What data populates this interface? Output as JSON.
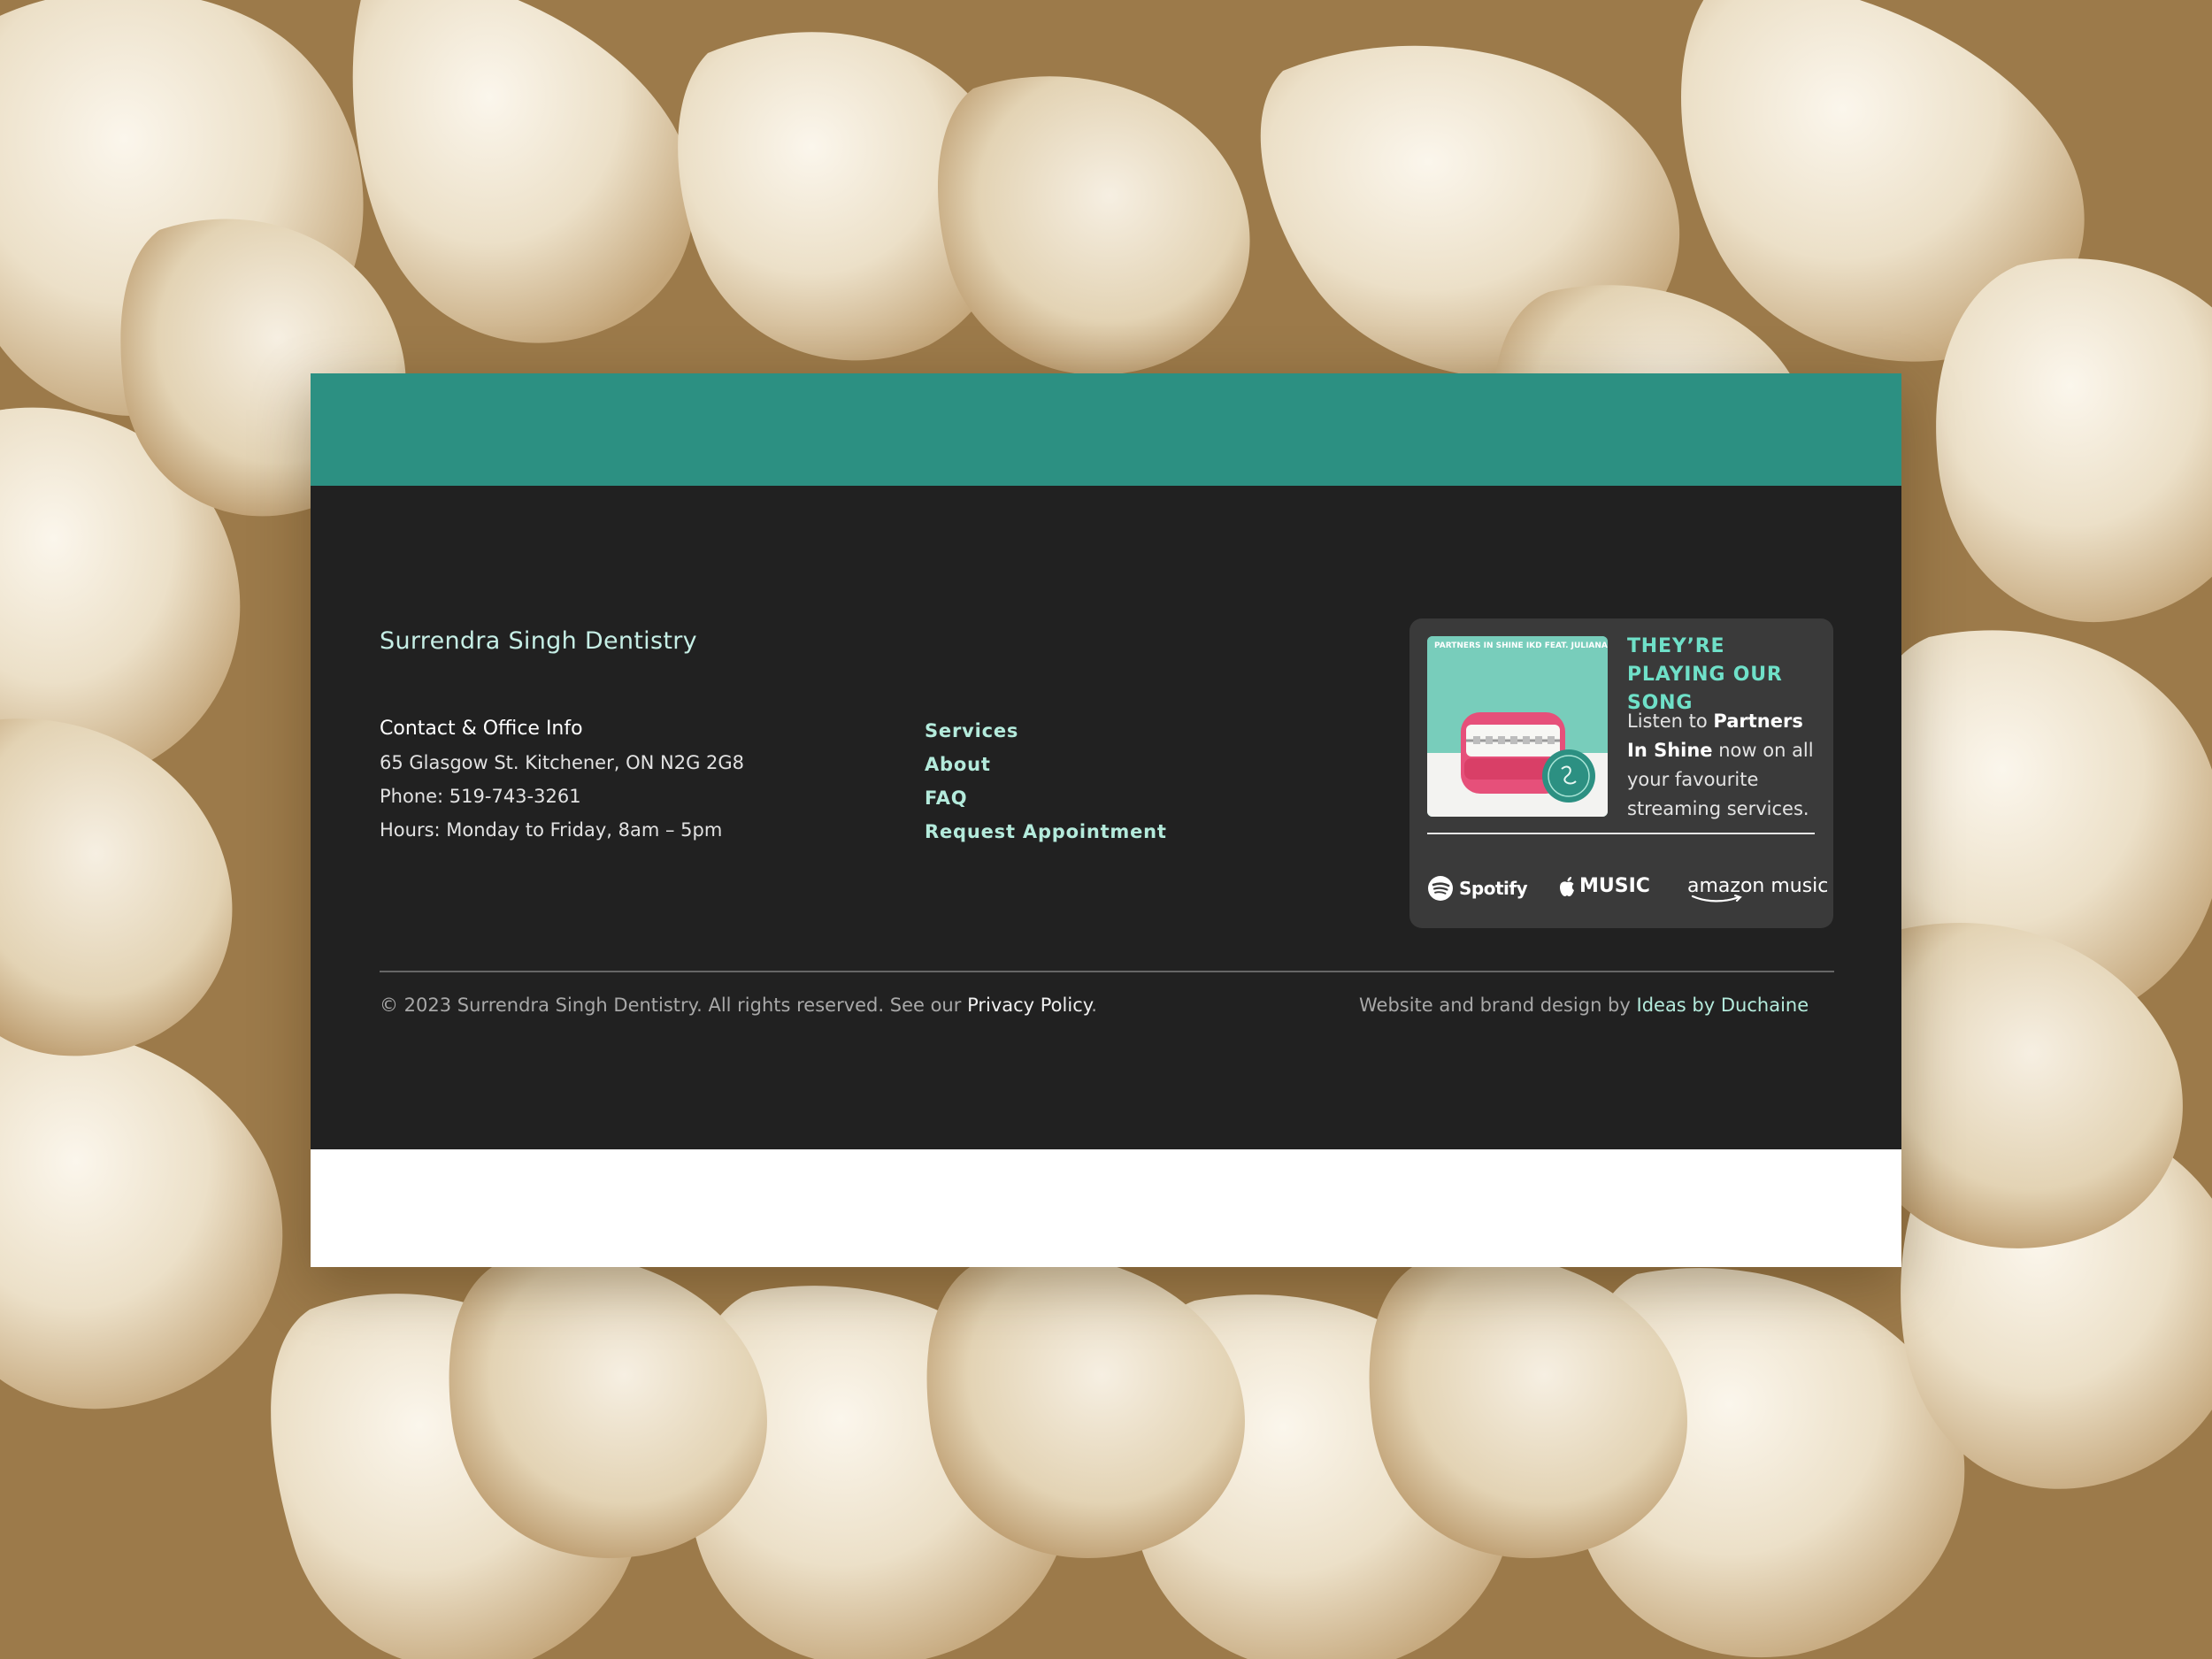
{
  "colors": {
    "teal_bar": "#2c9082",
    "footer_bg": "#212121",
    "brand_text": "#c6efe6",
    "link_text": "#b4ebdc",
    "song_heading": "#6fe0c8",
    "card_bg": "#3a3a3a"
  },
  "footer": {
    "brand": "Surrendra Singh Dentistry",
    "contact": {
      "heading": "Contact & Office Info",
      "address": "65 Glasgow St. Kitchener, ON N2G 2G8",
      "phone": "Phone: 519-743-3261",
      "hours": "Hours: Monday to Friday, 8am – 5pm"
    },
    "nav": [
      "Services",
      "About",
      "FAQ",
      "Request Appointment"
    ],
    "song_card": {
      "album_caption": "PARTNERS IN SHINE IKD FEAT. JULIANA P",
      "heading": "THEY’RE PLAYING OUR SONG",
      "text_before": "Listen to ",
      "text_bold": "Partners In Shine",
      "text_after": " now on all your favourite streaming services.",
      "services": [
        {
          "name": "Spotify",
          "icon": "spotify-icon"
        },
        {
          "name": "MUSIC",
          "icon": "apple-icon"
        },
        {
          "name": "amazon music",
          "icon": "amazon-smile-icon"
        }
      ]
    },
    "copyright_prefix": "© 2023 Surrendra Singh Dentistry. All rights reserved. See our ",
    "privacy_link": "Privacy Policy",
    "copyright_suffix": ".",
    "credit_prefix": "Website and brand design by ",
    "credit_link": "Ideas by Duchaine"
  }
}
